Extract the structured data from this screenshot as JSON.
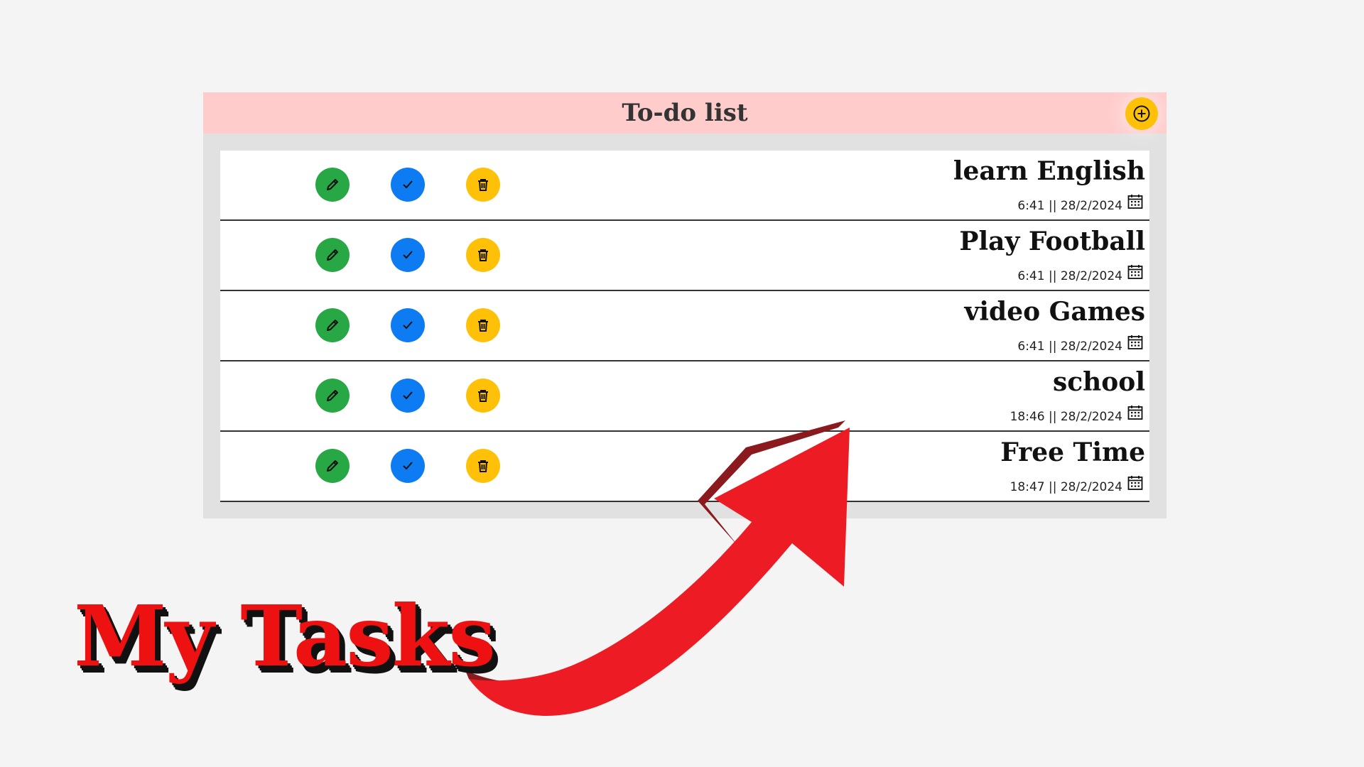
{
  "header": {
    "title": "To-do list",
    "add_icon": "plus-circle-icon"
  },
  "tasks": [
    {
      "title": "learn English",
      "time": "6:41 || 28/2/2024"
    },
    {
      "title": "Play Football",
      "time": "6:41 || 28/2/2024"
    },
    {
      "title": "video Games",
      "time": "6:41 || 28/2/2024"
    },
    {
      "title": "school",
      "time": "18:46 || 28/2/2024"
    },
    {
      "title": "Free Time",
      "time": "18:47 || 28/2/2024"
    }
  ],
  "row_icons": {
    "edit": "pencil-icon",
    "done": "check-icon",
    "delete": "trash-icon",
    "date": "calendar-icon"
  },
  "caption": "My Tasks",
  "colors": {
    "header_bg": "#ffcccc",
    "panel_bg": "#e1e1e1",
    "edit": "#28a745",
    "done": "#0d7cf2",
    "delete": "#ffc107",
    "add": "#ffc107",
    "arrow": "#ed1c24",
    "caption": "#ee1111"
  }
}
